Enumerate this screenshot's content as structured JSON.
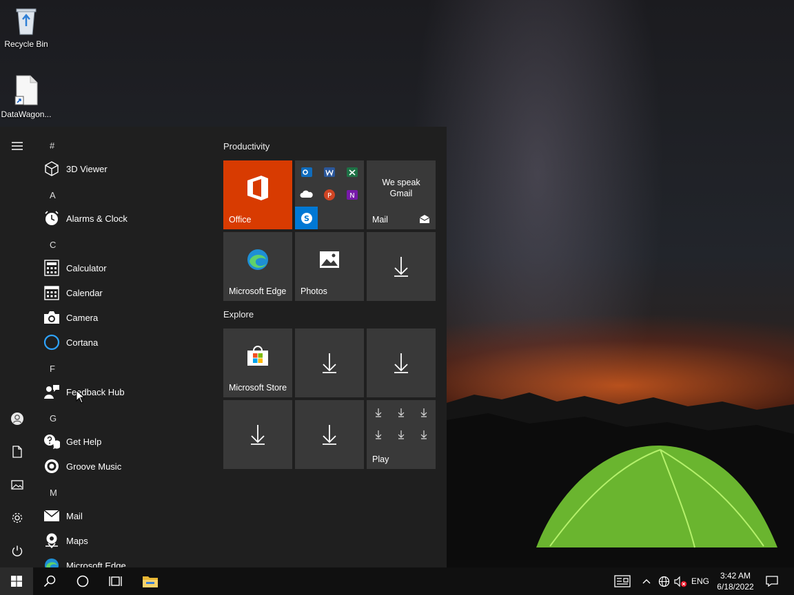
{
  "desktop": {
    "icons": [
      {
        "label": "Recycle Bin"
      },
      {
        "label": "DataWagon..."
      }
    ]
  },
  "start_menu": {
    "apps": {
      "letter_hash": "#",
      "viewer3d": "3D Viewer",
      "letter_a": "A",
      "alarms": "Alarms & Clock",
      "letter_c": "C",
      "calculator": "Calculator",
      "calendar": "Calendar",
      "camera": "Camera",
      "cortana": "Cortana",
      "letter_f": "F",
      "feedback": "Feedback Hub",
      "letter_g": "G",
      "gethelp": "Get Help",
      "groove": "Groove Music",
      "letter_m": "M",
      "mail": "Mail",
      "maps": "Maps",
      "edge": "Microsoft Edge"
    },
    "groups": {
      "productivity": "Productivity",
      "explore": "Explore"
    },
    "tiles": {
      "office": "Office",
      "mail_text": "We speak Gmail",
      "mail": "Mail",
      "edge": "Microsoft Edge",
      "photos": "Photos",
      "store": "Microsoft Store",
      "play": "Play"
    },
    "colors": {
      "office_tile": "#d83b01",
      "tile_bg": "#393939",
      "menu_bg": "#1f1f1f"
    }
  },
  "taskbar": {
    "language": "ENG",
    "time": "3:42 AM",
    "date": "6/18/2022"
  }
}
